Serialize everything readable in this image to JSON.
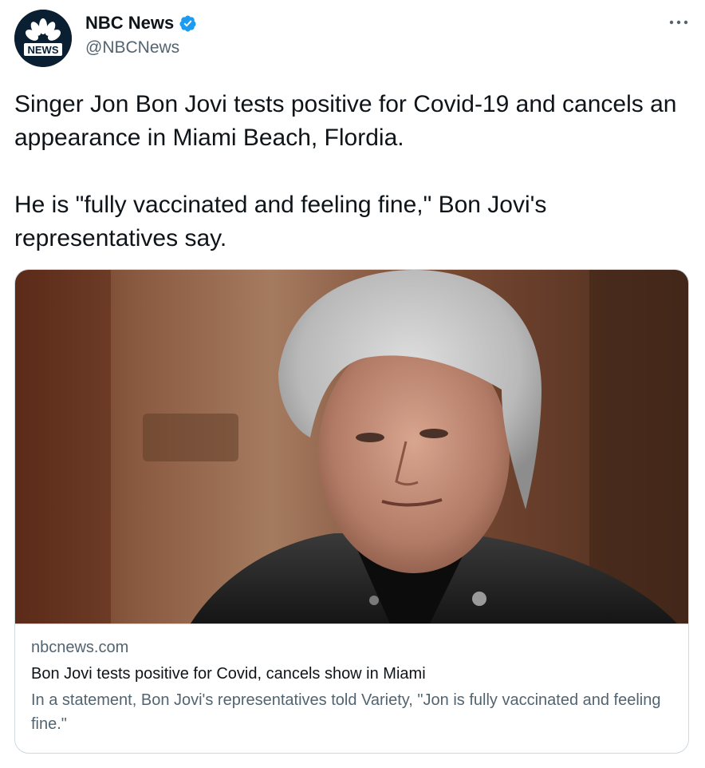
{
  "author": {
    "display_name": "NBC News",
    "handle": "@NBCNews",
    "avatar_label": "NEWS",
    "avatar_icon": "nbc-peacock-logo",
    "verified_icon": "verified-badge-icon",
    "verified_color": "#1d9bf0"
  },
  "menu": {
    "icon": "more-options-icon",
    "glyph": "···"
  },
  "tweet": {
    "text": "Singer Jon Bon Jovi tests positive for Covid-19 and cancels an appearance in Miami Beach, Flordia.\n\nHe is \"fully vaccinated and feeling fine,\" Bon Jovi's representatives say."
  },
  "link_card": {
    "domain": "nbcnews.com",
    "title": "Bon Jovi tests positive for Covid, cancels show in Miami",
    "description": "In a statement, Bon Jovi's representatives told Variety, \"Jon is fully vaccinated and feeling fine.\""
  },
  "colors": {
    "text_primary": "#0f1419",
    "text_secondary": "#536471",
    "border": "#cfd9de",
    "accent": "#1d9bf0"
  }
}
